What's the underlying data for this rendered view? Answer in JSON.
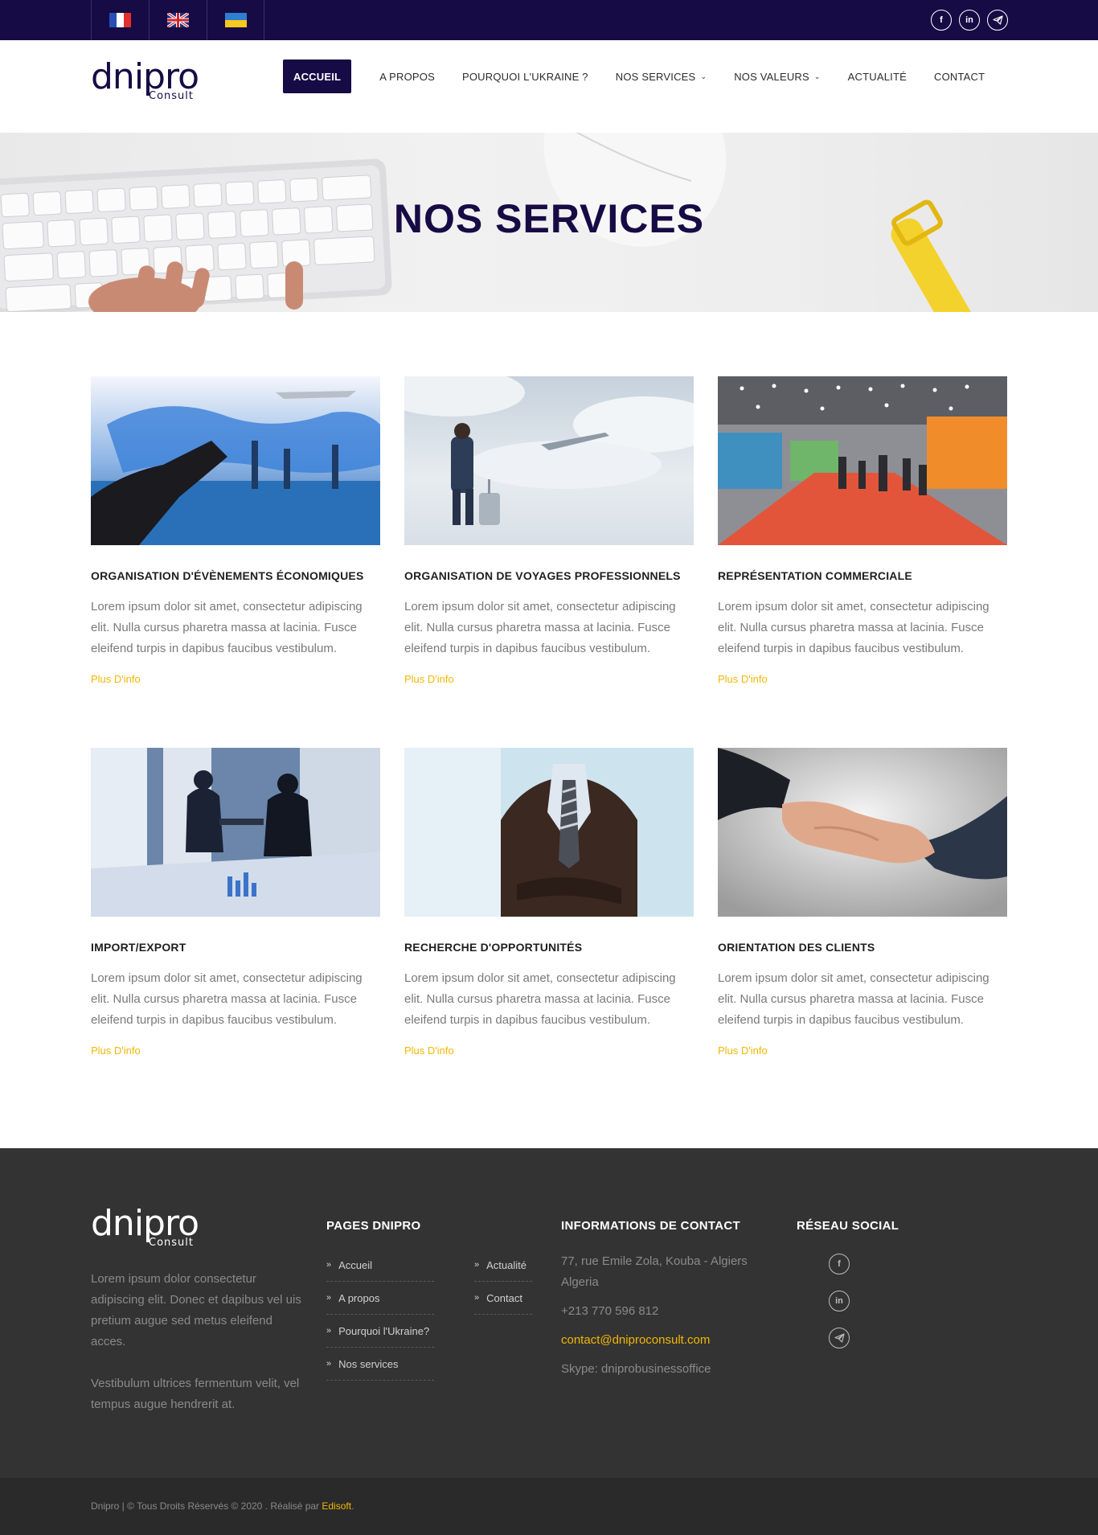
{
  "topbar": {
    "languages": [
      {
        "name": "flag-france-icon",
        "code": "fr"
      },
      {
        "name": "flag-uk-icon",
        "code": "en"
      },
      {
        "name": "flag-ukraine-icon",
        "code": "uk"
      }
    ],
    "social_icons": [
      "facebook-icon",
      "linkedin-icon",
      "telegram-icon"
    ]
  },
  "header": {
    "logo_word": "dnipro",
    "logo_sub": "Consult",
    "nav": [
      {
        "label": "ACCUEIL",
        "active": true,
        "dropdown": false
      },
      {
        "label": "A PROPOS",
        "active": false,
        "dropdown": false
      },
      {
        "label": "POURQUOI L'UKRAINE ?",
        "active": false,
        "dropdown": false
      },
      {
        "label": "NOS SERVICES",
        "active": false,
        "dropdown": true
      },
      {
        "label": "NOS VALEURS",
        "active": false,
        "dropdown": true
      },
      {
        "label": "ACTUALITÉ",
        "active": false,
        "dropdown": false
      },
      {
        "label": "CONTACT",
        "active": false,
        "dropdown": false
      }
    ],
    "dropdown_glyph": "⌄"
  },
  "hero": {
    "title": "NOS SERVICES"
  },
  "services": {
    "items": [
      {
        "title": "ORGANISATION D'ÉVÈNEMENTS ÉCONOMIQUES",
        "text": "Lorem ipsum dolor sit amet, consectetur adipiscing elit. Nulla cursus pharetra massa at lacinia. Fusce eleifend turpis in dapibus faucibus vestibulum.",
        "link": "Plus D'info"
      },
      {
        "title": "ORGANISATION DE VOYAGES PROFESSIONNELS",
        "text": "Lorem ipsum dolor sit amet, consectetur adipiscing elit. Nulla cursus pharetra massa at lacinia. Fusce eleifend turpis in dapibus faucibus vestibulum.",
        "link": "Plus D'info"
      },
      {
        "title": "REPRÉSENTATION COMMERCIALE",
        "text": "Lorem ipsum dolor sit amet, consectetur adipiscing elit. Nulla cursus pharetra massa at lacinia. Fusce eleifend turpis in dapibus faucibus vestibulum.",
        "link": "Plus D'info"
      },
      {
        "title": "IMPORT/EXPORT",
        "text": "Lorem ipsum dolor sit amet, consectetur adipiscing elit. Nulla cursus pharetra massa at lacinia. Fusce eleifend turpis in dapibus faucibus vestibulum.",
        "link": "Plus D'info"
      },
      {
        "title": "RECHERCHE D'OPPORTUNITÉS",
        "text": "Lorem ipsum dolor sit amet, consectetur adipiscing elit. Nulla cursus pharetra massa at lacinia. Fusce eleifend turpis in dapibus faucibus vestibulum.",
        "link": "Plus D'info"
      },
      {
        "title": "ORIENTATION DES CLIENTS",
        "text": "Lorem ipsum dolor sit amet, consectetur adipiscing elit. Nulla cursus pharetra massa at lacinia. Fusce eleifend turpis in dapibus faucibus vestibulum.",
        "link": "Plus D'info"
      }
    ]
  },
  "footer": {
    "about": [
      "Lorem ipsum dolor consectetur adipiscing elit. Donec et dapibus vel uis pretium augue sed metus eleifend acces.",
      "Vestibulum ultrices fermentum velit, vel tempus augue hendrerit at."
    ],
    "pages_heading": "PAGES DNIPRO",
    "pages_col1": [
      "Accueil",
      "A propos",
      "Pourquoi l'Ukraine?",
      "Nos services"
    ],
    "pages_col2": [
      "Actualité",
      "Contact"
    ],
    "link_glyph": "»",
    "contact_heading": "INFORMATIONS DE CONTACT",
    "address": "77, rue Emile Zola, Kouba - Algiers Algeria",
    "phone": "+213 770 596 812",
    "email": "contact@dniproconsult.com",
    "skype": "Skype: dniprobusinessoffice",
    "social_heading": "RÉSEAU SOCIAL",
    "copyright": "Dnipro | © Tous Droits Réservés © 2020 . Réalisé par ",
    "copyright_brand": "Edisoft",
    "copyright_end": "."
  },
  "colors": {
    "brand_navy": "#170b45",
    "accent_yellow": "#f2b705",
    "footer_bg": "#333333"
  }
}
